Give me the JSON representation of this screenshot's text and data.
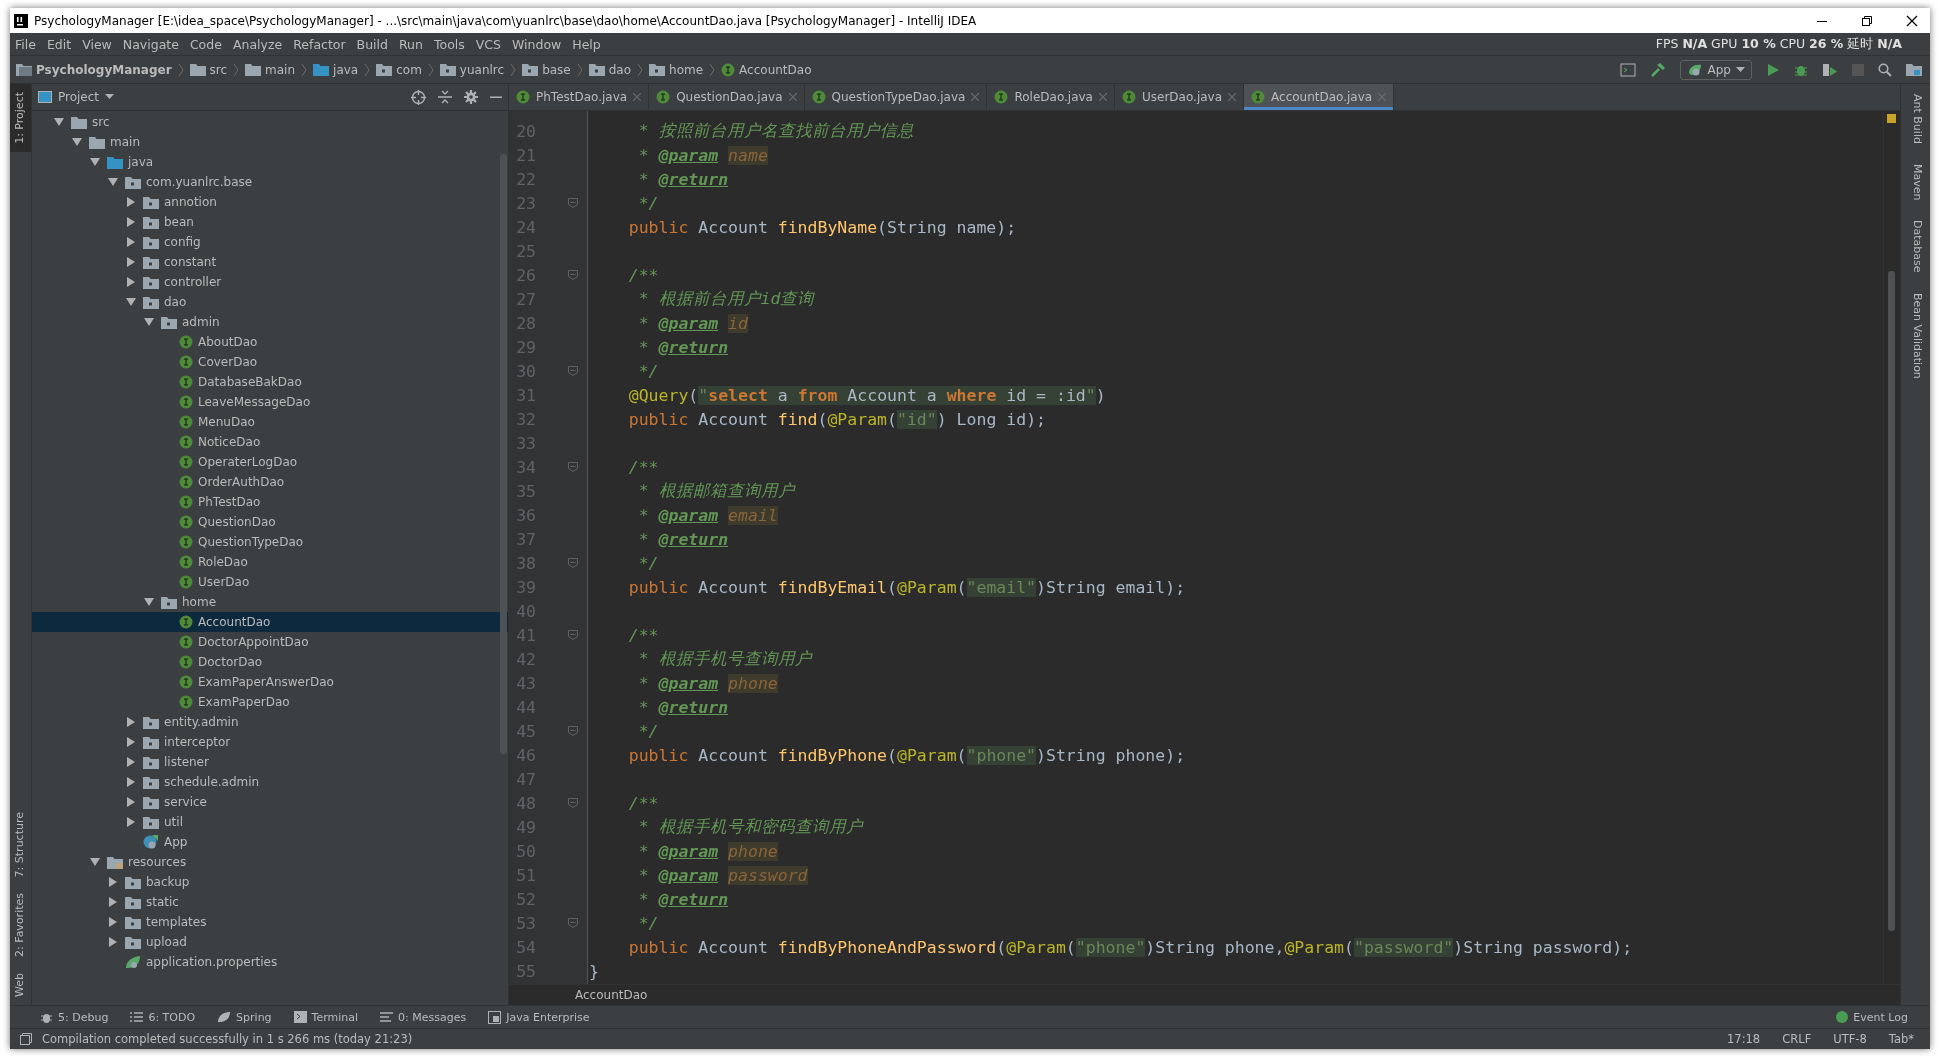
{
  "window": {
    "title": "PsychologyManager [E:\\idea_space\\PsychologyManager] - ...\\src\\main\\java\\com\\yuanlrc\\base\\dao\\home\\AccountDao.java [PsychologyManager] - IntelliJ IDEA"
  },
  "menu": [
    "File",
    "Edit",
    "View",
    "Navigate",
    "Code",
    "Analyze",
    "Refactor",
    "Build",
    "Run",
    "Tools",
    "VCS",
    "Window",
    "Help"
  ],
  "stats": "FPS **N/A** GPU **10 %** CPU **26 %** 延时 **N/A**",
  "breadcrumb": [
    {
      "label": "PsychologyManager",
      "kind": "project"
    },
    {
      "label": "src",
      "kind": "folder"
    },
    {
      "label": "main",
      "kind": "folder"
    },
    {
      "label": "java",
      "kind": "source_folder"
    },
    {
      "label": "com",
      "kind": "package"
    },
    {
      "label": "yuanlrc",
      "kind": "package"
    },
    {
      "label": "base",
      "kind": "package"
    },
    {
      "label": "dao",
      "kind": "package"
    },
    {
      "label": "home",
      "kind": "package"
    },
    {
      "label": "AccountDao",
      "kind": "interface"
    }
  ],
  "run_config": "App",
  "left_stripe": [
    {
      "label": "1: Project",
      "selected": true
    },
    {
      "label": "7: Structure",
      "selected": false
    },
    {
      "label": "2: Favorites",
      "selected": false
    },
    {
      "label": "Web",
      "selected": false
    }
  ],
  "right_stripe": [
    "Ant Build",
    "Maven",
    "Database",
    "Bean Validation"
  ],
  "project_panel": {
    "title": "Project"
  },
  "project_tree": [
    {
      "label": "src",
      "kind": "folder",
      "expanded": true,
      "selected": false,
      "children": [
        {
          "label": "main",
          "kind": "folder",
          "expanded": true,
          "selected": false,
          "children": [
            {
              "label": "java",
              "kind": "source_folder",
              "expanded": true,
              "selected": false,
              "children": [
                {
                  "label": "com.yuanlrc.base",
                  "kind": "package",
                  "expanded": true,
                  "selected": false,
                  "children": [
                    {
                      "label": "annotion",
                      "kind": "package",
                      "expanded": false,
                      "selected": false
                    },
                    {
                      "label": "bean",
                      "kind": "package",
                      "expanded": false,
                      "selected": false
                    },
                    {
                      "label": "config",
                      "kind": "package",
                      "expanded": false,
                      "selected": false
                    },
                    {
                      "label": "constant",
                      "kind": "package",
                      "expanded": false,
                      "selected": false
                    },
                    {
                      "label": "controller",
                      "kind": "package",
                      "expanded": false,
                      "selected": false
                    },
                    {
                      "label": "dao",
                      "kind": "package",
                      "expanded": true,
                      "selected": false,
                      "children": [
                        {
                          "label": "admin",
                          "kind": "package",
                          "expanded": true,
                          "selected": false,
                          "children": [
                            {
                              "label": "AboutDao",
                              "kind": "interface",
                              "selected": false
                            },
                            {
                              "label": "CoverDao",
                              "kind": "interface",
                              "selected": false
                            },
                            {
                              "label": "DatabaseBakDao",
                              "kind": "interface",
                              "selected": false
                            },
                            {
                              "label": "LeaveMessageDao",
                              "kind": "interface",
                              "selected": false
                            },
                            {
                              "label": "MenuDao",
                              "kind": "interface",
                              "selected": false
                            },
                            {
                              "label": "NoticeDao",
                              "kind": "interface",
                              "selected": false
                            },
                            {
                              "label": "OperaterLogDao",
                              "kind": "interface",
                              "selected": false
                            },
                            {
                              "label": "OrderAuthDao",
                              "kind": "interface",
                              "selected": false
                            },
                            {
                              "label": "PhTestDao",
                              "kind": "interface",
                              "selected": false
                            },
                            {
                              "label": "QuestionDao",
                              "kind": "interface",
                              "selected": false
                            },
                            {
                              "label": "QuestionTypeDao",
                              "kind": "interface",
                              "selected": false
                            },
                            {
                              "label": "RoleDao",
                              "kind": "interface",
                              "selected": false
                            },
                            {
                              "label": "UserDao",
                              "kind": "interface",
                              "selected": false
                            }
                          ]
                        },
                        {
                          "label": "home",
                          "kind": "package",
                          "expanded": true,
                          "selected": false,
                          "children": [
                            {
                              "label": "AccountDao",
                              "kind": "interface",
                              "selected": true
                            },
                            {
                              "label": "DoctorAppointDao",
                              "kind": "interface",
                              "selected": false
                            },
                            {
                              "label": "DoctorDao",
                              "kind": "interface",
                              "selected": false
                            },
                            {
                              "label": "ExamPaperAnswerDao",
                              "kind": "interface",
                              "selected": false
                            },
                            {
                              "label": "ExamPaperDao",
                              "kind": "interface",
                              "selected": false
                            }
                          ]
                        }
                      ]
                    },
                    {
                      "label": "entity.admin",
                      "kind": "package",
                      "expanded": false,
                      "selected": false
                    },
                    {
                      "label": "interceptor",
                      "kind": "package",
                      "expanded": false,
                      "selected": false
                    },
                    {
                      "label": "listener",
                      "kind": "package",
                      "expanded": false,
                      "selected": false
                    },
                    {
                      "label": "schedule.admin",
                      "kind": "package",
                      "expanded": false,
                      "selected": false
                    },
                    {
                      "label": "service",
                      "kind": "package",
                      "expanded": false,
                      "selected": false
                    },
                    {
                      "label": "util",
                      "kind": "package",
                      "expanded": false,
                      "selected": false
                    },
                    {
                      "label": "App",
                      "kind": "app",
                      "selected": false
                    }
                  ]
                }
              ]
            },
            {
              "label": "resources",
              "kind": "resources",
              "expanded": true,
              "selected": false,
              "children": [
                {
                  "label": "backup",
                  "kind": "package",
                  "expanded": false,
                  "selected": false
                },
                {
                  "label": "static",
                  "kind": "package",
                  "expanded": false,
                  "selected": false
                },
                {
                  "label": "templates",
                  "kind": "package",
                  "expanded": false,
                  "selected": false
                },
                {
                  "label": "upload",
                  "kind": "package",
                  "expanded": false,
                  "selected": false
                },
                {
                  "label": "application.properties",
                  "kind": "properties",
                  "selected": false
                }
              ]
            }
          ]
        }
      ]
    }
  ],
  "tabs": [
    {
      "label": "PhTestDao.java",
      "selected": false
    },
    {
      "label": "QuestionDao.java",
      "selected": false
    },
    {
      "label": "QuestionTypeDao.java",
      "selected": false
    },
    {
      "label": "RoleDao.java",
      "selected": false
    },
    {
      "label": "UserDao.java",
      "selected": false
    },
    {
      "label": "AccountDao.java",
      "selected": true
    }
  ],
  "code_lines": [
    {
      "num": "20",
      "fold": false,
      "tokens": [
        {
          "kind": "doc",
          "text": "     * 按照前台用户名查找前台用户信息"
        }
      ]
    },
    {
      "num": "21",
      "fold": false,
      "tokens": [
        {
          "kind": "doc",
          "text": "     * "
        },
        {
          "kind": "doc_tag",
          "text": "@param"
        },
        {
          "kind": "doc_param",
          "text": "name"
        }
      ]
    },
    {
      "num": "22",
      "fold": false,
      "tokens": [
        {
          "kind": "doc",
          "text": "     * "
        },
        {
          "kind": "doc_tag",
          "text": "@return"
        }
      ]
    },
    {
      "num": "23",
      "fold": true,
      "tokens": [
        {
          "kind": "doc",
          "text": "     */"
        }
      ]
    },
    {
      "num": "24",
      "fold": false,
      "tokens": [
        {
          "kind": "keyword",
          "text": "    public"
        },
        {
          "kind": "plain",
          "text": " Account "
        },
        {
          "kind": "method",
          "text": "findByName"
        },
        {
          "kind": "plain",
          "text": "(String name);"
        }
      ]
    },
    {
      "num": "25",
      "fold": false
    },
    {
      "num": "26",
      "fold": true,
      "tokens": [
        {
          "kind": "doc",
          "text": "    /**"
        }
      ]
    },
    {
      "num": "27",
      "fold": false,
      "tokens": [
        {
          "kind": "doc",
          "text": "     * 根据前台用户id查询"
        }
      ]
    },
    {
      "num": "28",
      "fold": false,
      "tokens": [
        {
          "kind": "doc",
          "text": "     * "
        },
        {
          "kind": "doc_tag",
          "text": "@param"
        },
        {
          "kind": "doc_param",
          "text": "id"
        }
      ]
    },
    {
      "num": "29",
      "fold": false,
      "tokens": [
        {
          "kind": "doc",
          "text": "     * "
        },
        {
          "kind": "doc_tag",
          "text": "@return"
        }
      ]
    },
    {
      "num": "30",
      "fold": true,
      "tokens": [
        {
          "kind": "doc",
          "text": "     */"
        }
      ]
    },
    {
      "num": "31",
      "fold": false,
      "tokens": [
        {
          "kind": "annotation",
          "text": "    @Query"
        },
        {
          "kind": "plain",
          "text": "("
        },
        {
          "kind": "string",
          "text": "\""
        },
        {
          "kind": "sql_keyword",
          "text": "select"
        },
        {
          "kind": "sql",
          "text": " a "
        },
        {
          "kind": "sql_keyword",
          "text": "from"
        },
        {
          "kind": "sql",
          "text": " Account a "
        },
        {
          "kind": "sql_keyword",
          "text": "where"
        },
        {
          "kind": "sql",
          "text": " id = :id"
        },
        {
          "kind": "string",
          "text": "\""
        },
        {
          "kind": "plain",
          "text": ")"
        }
      ]
    },
    {
      "num": "32",
      "fold": false,
      "tokens": [
        {
          "kind": "keyword",
          "text": "    public"
        },
        {
          "kind": "plain",
          "text": " Account "
        },
        {
          "kind": "method",
          "text": "find"
        },
        {
          "kind": "plain",
          "text": "("
        },
        {
          "kind": "annotation",
          "text": "@Param"
        },
        {
          "kind": "plain",
          "text": "("
        },
        {
          "kind": "string",
          "text": "\"id\""
        },
        {
          "kind": "plain",
          "text": ") Long id);"
        }
      ]
    },
    {
      "num": "33",
      "fold": false
    },
    {
      "num": "34",
      "fold": true,
      "tokens": [
        {
          "kind": "doc",
          "text": "    /**"
        }
      ]
    },
    {
      "num": "35",
      "fold": false,
      "tokens": [
        {
          "kind": "doc",
          "text": "     * 根据邮箱查询用户"
        }
      ]
    },
    {
      "num": "36",
      "fold": false,
      "tokens": [
        {
          "kind": "doc",
          "text": "     * "
        },
        {
          "kind": "doc_tag",
          "text": "@param"
        },
        {
          "kind": "doc_param",
          "text": "email"
        }
      ]
    },
    {
      "num": "37",
      "fold": false,
      "tokens": [
        {
          "kind": "doc",
          "text": "     * "
        },
        {
          "kind": "doc_tag",
          "text": "@return"
        }
      ]
    },
    {
      "num": "38",
      "fold": true,
      "tokens": [
        {
          "kind": "doc",
          "text": "     */"
        }
      ]
    },
    {
      "num": "39",
      "fold": false,
      "tokens": [
        {
          "kind": "keyword",
          "text": "    public"
        },
        {
          "kind": "plain",
          "text": " Account "
        },
        {
          "kind": "method",
          "text": "findByEmail"
        },
        {
          "kind": "plain",
          "text": "("
        },
        {
          "kind": "annotation",
          "text": "@Param"
        },
        {
          "kind": "plain",
          "text": "("
        },
        {
          "kind": "string",
          "text": "\"email\""
        },
        {
          "kind": "plain",
          "text": ")String email);"
        }
      ]
    },
    {
      "num": "40",
      "fold": false
    },
    {
      "num": "41",
      "fold": true,
      "tokens": [
        {
          "kind": "doc",
          "text": "    /**"
        }
      ]
    },
    {
      "num": "42",
      "fold": false,
      "tokens": [
        {
          "kind": "doc",
          "text": "     * 根据手机号查询用户"
        }
      ]
    },
    {
      "num": "43",
      "fold": false,
      "tokens": [
        {
          "kind": "doc",
          "text": "     * "
        },
        {
          "kind": "doc_tag",
          "text": "@param"
        },
        {
          "kind": "doc_param",
          "text": "phone"
        }
      ]
    },
    {
      "num": "44",
      "fold": false,
      "tokens": [
        {
          "kind": "doc",
          "text": "     * "
        },
        {
          "kind": "doc_tag",
          "text": "@return"
        }
      ]
    },
    {
      "num": "45",
      "fold": true,
      "tokens": [
        {
          "kind": "doc",
          "text": "     */"
        }
      ]
    },
    {
      "num": "46",
      "fold": false,
      "tokens": [
        {
          "kind": "keyword",
          "text": "    public"
        },
        {
          "kind": "plain",
          "text": " Account "
        },
        {
          "kind": "method",
          "text": "findByPhone"
        },
        {
          "kind": "plain",
          "text": "("
        },
        {
          "kind": "annotation",
          "text": "@Param"
        },
        {
          "kind": "plain",
          "text": "("
        },
        {
          "kind": "string",
          "text": "\"phone\""
        },
        {
          "kind": "plain",
          "text": ")String phone);"
        }
      ]
    },
    {
      "num": "47",
      "fold": false
    },
    {
      "num": "48",
      "fold": true,
      "tokens": [
        {
          "kind": "doc",
          "text": "    /**"
        }
      ]
    },
    {
      "num": "49",
      "fold": false,
      "tokens": [
        {
          "kind": "doc",
          "text": "     * 根据手机号和密码查询用户"
        }
      ]
    },
    {
      "num": "50",
      "fold": false,
      "tokens": [
        {
          "kind": "doc",
          "text": "     * "
        },
        {
          "kind": "doc_tag",
          "text": "@param"
        },
        {
          "kind": "doc_param",
          "text": "phone"
        }
      ]
    },
    {
      "num": "51",
      "fold": false,
      "tokens": [
        {
          "kind": "doc",
          "text": "     * "
        },
        {
          "kind": "doc_tag",
          "text": "@param"
        },
        {
          "kind": "doc_param",
          "text": "password"
        }
      ]
    },
    {
      "num": "52",
      "fold": false,
      "tokens": [
        {
          "kind": "doc",
          "text": "     * "
        },
        {
          "kind": "doc_tag",
          "text": "@return"
        }
      ]
    },
    {
      "num": "53",
      "fold": true,
      "tokens": [
        {
          "kind": "doc",
          "text": "     */"
        }
      ]
    },
    {
      "num": "54",
      "fold": false,
      "tokens": [
        {
          "kind": "keyword",
          "text": "    public"
        },
        {
          "kind": "plain",
          "text": " Account "
        },
        {
          "kind": "method",
          "text": "findByPhoneAndPassword"
        },
        {
          "kind": "plain",
          "text": "("
        },
        {
          "kind": "annotation",
          "text": "@Param"
        },
        {
          "kind": "plain",
          "text": "("
        },
        {
          "kind": "string",
          "text": "\"phone\""
        },
        {
          "kind": "plain",
          "text": ")String phone,"
        },
        {
          "kind": "annotation",
          "text": "@Param"
        },
        {
          "kind": "plain",
          "text": "("
        },
        {
          "kind": "string",
          "text": "\"password\""
        },
        {
          "kind": "plain",
          "text": ")String password);"
        }
      ]
    },
    {
      "num": "55",
      "fold": false,
      "tokens": [
        {
          "kind": "plain",
          "text": "}"
        }
      ]
    }
  ],
  "editor_breadcrumb": "AccountDao",
  "tool_tabs": [
    {
      "label": "5: Debug",
      "kind": "debug"
    },
    {
      "label": "6: TODO",
      "kind": "todo"
    },
    {
      "label": "Spring",
      "kind": "spring"
    },
    {
      "label": "Terminal",
      "kind": "terminal"
    },
    {
      "label": "0: Messages",
      "kind": "messages"
    },
    {
      "label": "Java Enterprise",
      "kind": "enterprise"
    }
  ],
  "event_log": "Event Log",
  "status": {
    "message": "Compilation completed successfully in 1 s 266 ms (today 21:23)",
    "position": "17:18",
    "line_separator": "CRLF",
    "encoding": "UTF-8",
    "indent": "Tab*"
  }
}
